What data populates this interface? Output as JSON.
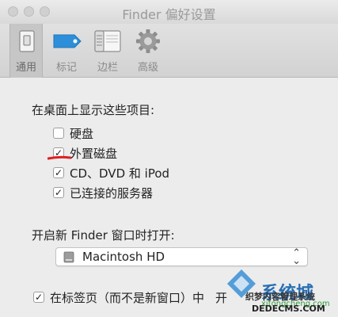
{
  "window": {
    "title": "Finder 偏好设置"
  },
  "toolbar": {
    "tabs": [
      {
        "label": "通用",
        "icon": "general-switch-icon"
      },
      {
        "label": "标记",
        "icon": "tag-icon"
      },
      {
        "label": "边栏",
        "icon": "sidebar-icon"
      },
      {
        "label": "高级",
        "icon": "gear-icon"
      }
    ],
    "active": "通用"
  },
  "desktop": {
    "heading": "在桌面上显示这些项目:",
    "items": [
      {
        "label": "硬盘",
        "checked": false
      },
      {
        "label": "外置磁盘",
        "checked": true
      },
      {
        "label": "CD、DVD 和 iPod",
        "checked": true
      },
      {
        "label": "已连接的服务器",
        "checked": true
      }
    ]
  },
  "new_window": {
    "heading": "开启新 Finder 窗口时打开:",
    "selected": "Macintosh HD"
  },
  "tabs_option": {
    "label": "在标签页（而不是新窗口）中",
    "label_tail": "开",
    "checked": true
  },
  "watermark": {
    "brand": "系统城",
    "domain": "xitongcheng.com",
    "site_cn": "织梦内容管理系统",
    "site_en": "DEDECMS.COM"
  },
  "colors": {
    "accent_blue": "#2d8fd9",
    "annotation_red": "#e02020",
    "watermark_blue": "#2a6fb3"
  }
}
